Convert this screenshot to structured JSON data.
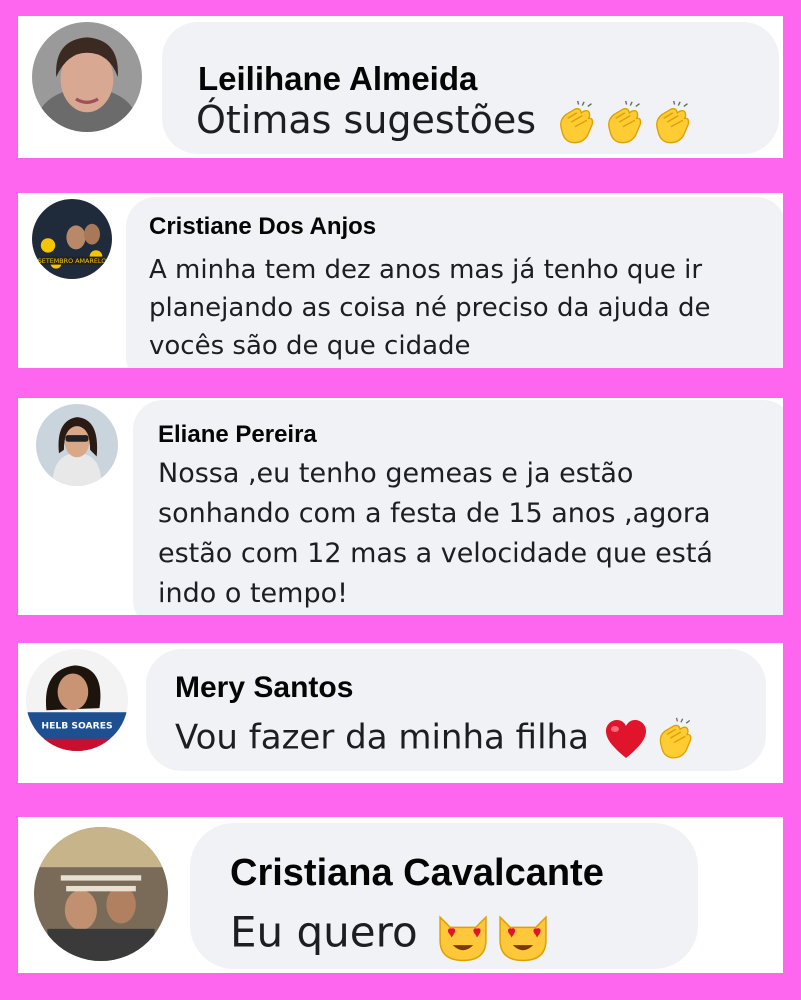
{
  "comments": [
    {
      "name": "Leilihane Almeida",
      "lines": [
        "Ótimas sugestões"
      ],
      "emojis": [
        "clapping-hands",
        "clapping-hands",
        "clapping-hands"
      ]
    },
    {
      "name": "Cristiane Dos Anjos",
      "lines": [
        "A minha tem dez anos mas já tenho que ir",
        "planejando as coisa né preciso da ajuda de",
        "vocês são de que cidade"
      ],
      "avatar_text": "SETEMBRO AMARELO"
    },
    {
      "name": "Eliane Pereira",
      "lines": [
        "Nossa ,eu tenho gemeas e ja estão",
        "sonhando com a festa de  15 anos ,agora",
        "estão com 12  mas a velocidade que está",
        "indo o tempo!"
      ]
    },
    {
      "name": "Mery Santos",
      "lines": [
        "Vou fazer da minha filha"
      ],
      "emojis": [
        "red-heart",
        "clapping-hands"
      ],
      "avatar_text": "HELB SOARES"
    },
    {
      "name": "Cristiana Cavalcante",
      "lines": [
        "Eu quero"
      ],
      "emojis": [
        "heart-eyes-cat",
        "heart-eyes-cat"
      ]
    }
  ],
  "colors": {
    "background": "#ff66f0",
    "panel": "#ffffff",
    "bubble": "#f0f2f5",
    "name": "#050505",
    "text": "#1c1e21"
  }
}
